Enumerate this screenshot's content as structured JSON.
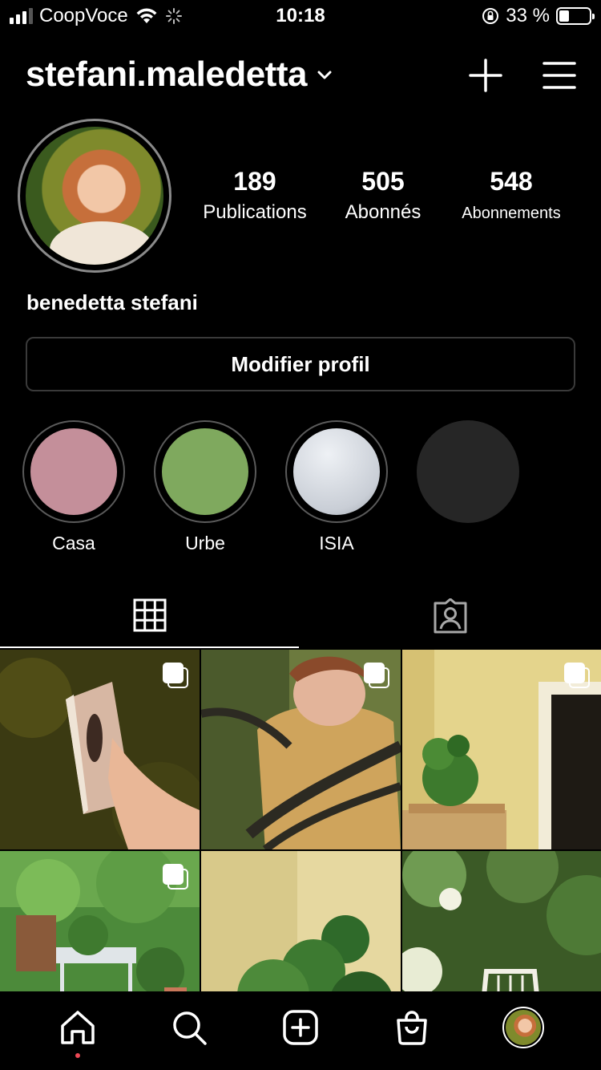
{
  "status_bar": {
    "carrier": "CoopVoce",
    "time": "10:18",
    "battery": "33 %",
    "battery_level": 0.33
  },
  "header": {
    "username": "stefani.maledetta"
  },
  "profile": {
    "full_name": "benedetta stefani",
    "stats": [
      {
        "count": "189",
        "label": "Publications"
      },
      {
        "count": "505",
        "label": "Abonnés"
      },
      {
        "count": "548",
        "label": "Abonnements"
      }
    ],
    "edit_button": "Modifier profil"
  },
  "highlights": [
    {
      "label": "Casa",
      "color": "#c48f9a"
    },
    {
      "label": "Urbe",
      "color": "#7fa95e"
    },
    {
      "label": "ISIA",
      "color": "#d6dbe2"
    },
    {
      "label": "",
      "color": "#262626"
    }
  ],
  "tabs": [
    {
      "name": "grid",
      "icon": "grid-icon",
      "active": true
    },
    {
      "name": "tagged",
      "icon": "tagged-person-icon",
      "active": false
    }
  ],
  "photos": [
    {
      "desc": "book-in-hand",
      "multi": true,
      "colors": [
        "#3b3a12",
        "#d7b7a3"
      ]
    },
    {
      "desc": "woman-with-chair",
      "multi": true,
      "colors": [
        "#cfa45c",
        "#2c2a22"
      ]
    },
    {
      "desc": "plant-in-room",
      "multi": true,
      "colors": [
        "#e4d48c",
        "#3d7a2d"
      ]
    },
    {
      "desc": "garden-plants",
      "multi": true,
      "colors": [
        "#4c8a3a",
        "#e0e5e8"
      ]
    },
    {
      "desc": "monstera-plant",
      "multi": false,
      "colors": [
        "#d8c98a",
        "#2f6a2a"
      ]
    },
    {
      "desc": "garden-chair",
      "multi": false,
      "colors": [
        "#3b5a26",
        "#f2f0e6"
      ]
    }
  ],
  "bottom_nav": [
    {
      "name": "home",
      "icon": "home-icon"
    },
    {
      "name": "search",
      "icon": "search-icon"
    },
    {
      "name": "create",
      "icon": "add-post-icon"
    },
    {
      "name": "shop",
      "icon": "shop-bag-icon"
    },
    {
      "name": "profile",
      "icon": "profile-avatar-icon"
    }
  ]
}
